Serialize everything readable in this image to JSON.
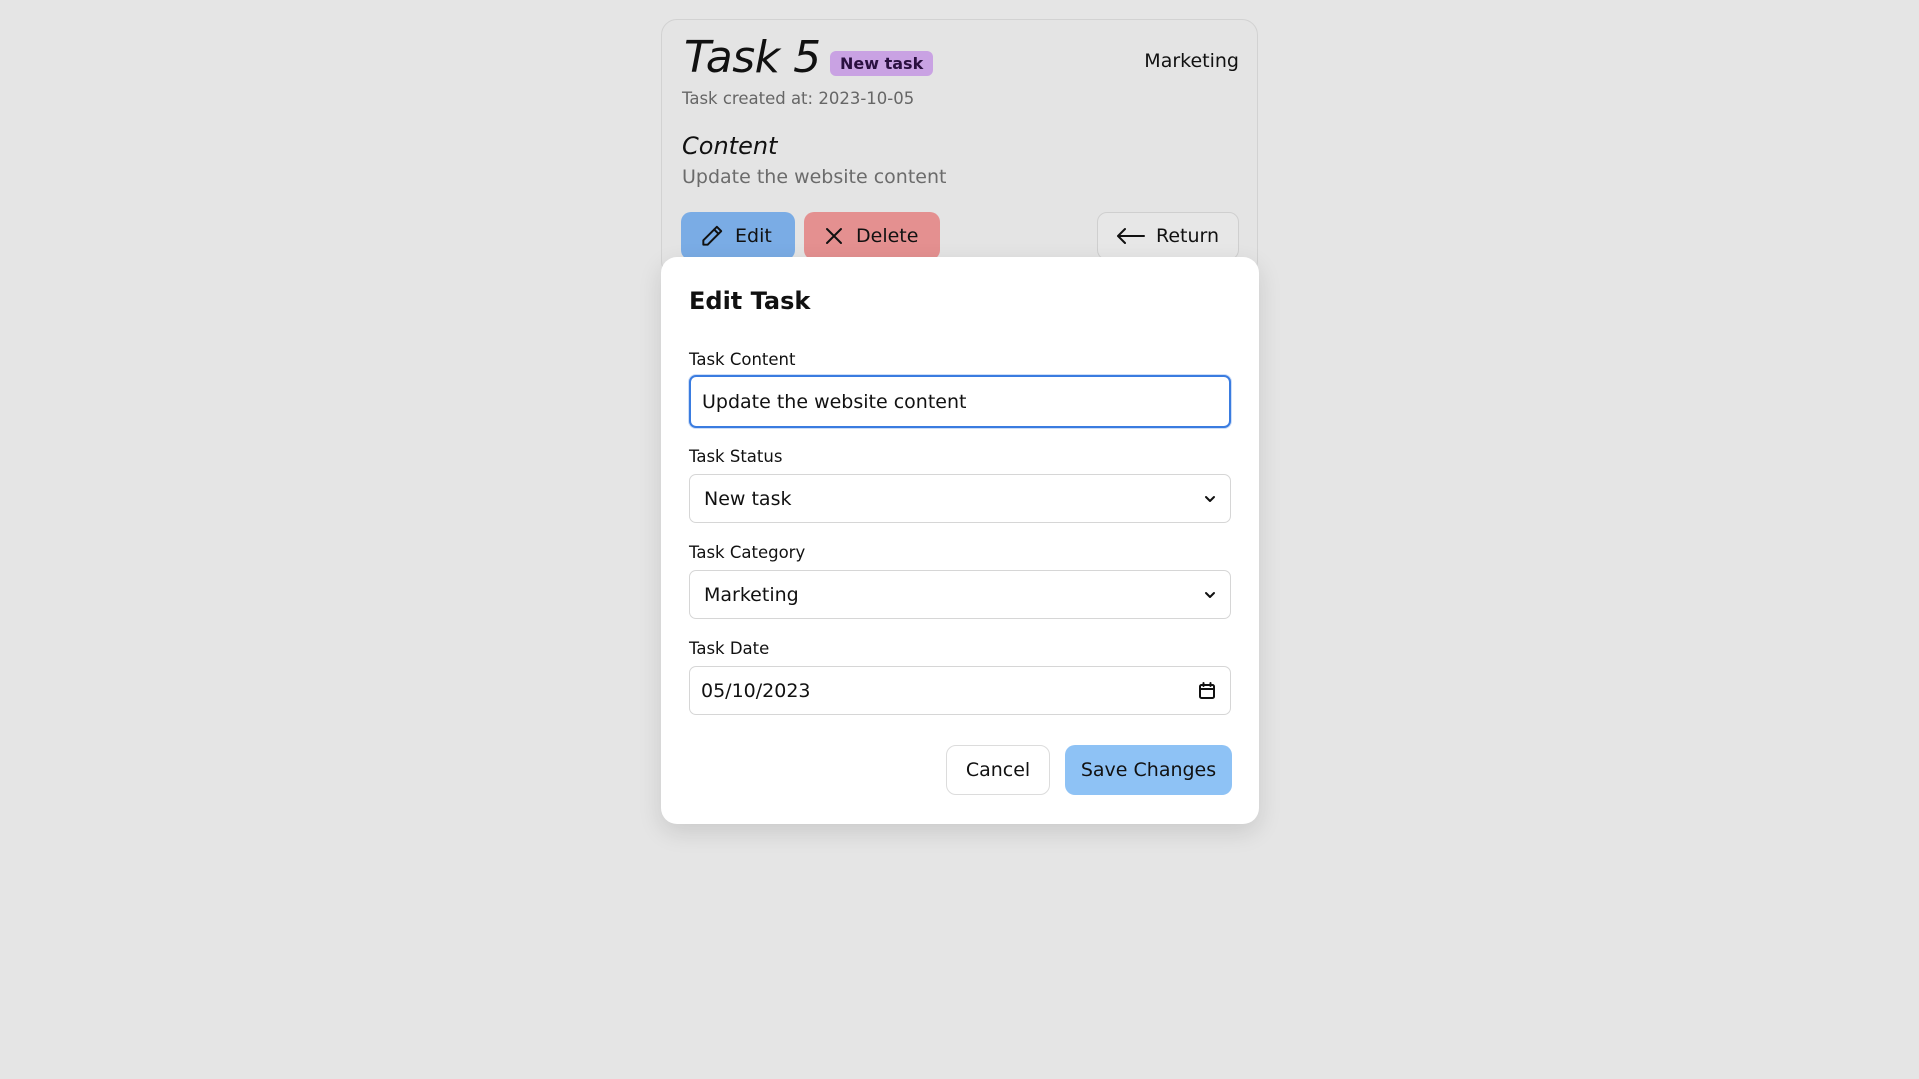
{
  "task_card": {
    "title": "Task 5",
    "status_badge": "New task",
    "category": "Marketing",
    "created_at": "Task created at: 2023-10-05",
    "content_heading": "Content",
    "content_text": "Update the website content",
    "buttons": {
      "edit": "Edit",
      "delete": "Delete",
      "return": "Return"
    }
  },
  "edit_modal": {
    "title": "Edit Task",
    "fields": {
      "content": {
        "label": "Task Content",
        "value": "Update the website content"
      },
      "status": {
        "label": "Task Status",
        "value": "New task"
      },
      "category": {
        "label": "Task Category",
        "value": "Marketing"
      },
      "date": {
        "label": "Task Date",
        "value": "05/10/2023"
      }
    },
    "buttons": {
      "cancel": "Cancel",
      "save": "Save Changes"
    }
  },
  "colors": {
    "page_background": "#e5e5e5",
    "badge_purple": "#c9a2e3",
    "edit_blue": "#7aace5",
    "delete_red": "#e49090",
    "save_blue": "#8ec2f5",
    "focus_blue": "#3a7ce0"
  },
  "icons": {
    "edit": "pencil-icon",
    "delete": "close-icon",
    "return": "arrow-left-icon",
    "select": "chevron-down-icon",
    "date": "calendar-icon"
  }
}
